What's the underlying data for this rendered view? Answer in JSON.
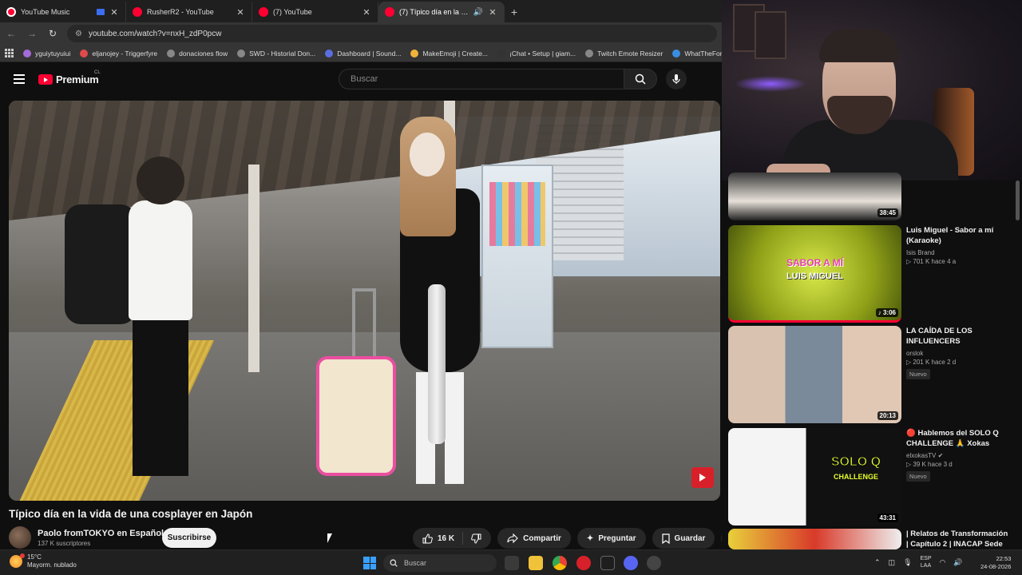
{
  "browser": {
    "tabs": [
      {
        "title": "YouTube Music",
        "icon": "youtube-music-icon"
      },
      {
        "title": "RusherR2 - YouTube",
        "icon": "youtube-icon"
      },
      {
        "title": "(7) YouTube",
        "icon": "youtube-icon"
      },
      {
        "title": "(7) Típico día en la vida de una cosplayer en Japón",
        "icon": "youtube-icon"
      }
    ],
    "url": "youtube.com/watch?v=nxH_zdP0pcw",
    "bookmarks": [
      "yguiytuyuiui",
      "eljanojey - Triggerfyre",
      "donaciones flow",
      "SWD - Historial Don...",
      "Dashboard | Sound...",
      "MakeEmoji | Create...",
      "¡Chat • Setup | giam...",
      "Twitch Emote Resizer",
      "WhatTheFont Font |..."
    ]
  },
  "youtube": {
    "logo_text": "Premium",
    "country_code": "CL",
    "search_placeholder": "Buscar",
    "video": {
      "title": "Típico día en la vida de una cosplayer en Japón",
      "channel_name": "Paolo fromTOKYO en Español",
      "subscribers": "137 K suscriptores",
      "subscribe_label": "Suscribirse",
      "likes": "16 K",
      "share_label": "Compartir",
      "ask_label": "Preguntar",
      "save_label": "Guardar"
    },
    "recommendations": [
      {
        "title": "",
        "channel": "",
        "meta": "",
        "duration": "38:45",
        "badge": ""
      },
      {
        "title": "Luis Miguel - Sabor a mí (Karaoke)",
        "channel": "Isis Brand",
        "meta": "▷ 701 K  hace 4 a",
        "duration": "3:06",
        "badge": "",
        "thumb_text_1": "SABOR A MÍ",
        "thumb_text_2": "LUIS MIGUEL"
      },
      {
        "title": "LA CAÍDA DE LOS INFLUENCERS",
        "channel": "orslok",
        "meta": "▷ 201 K  hace 2 d",
        "duration": "20:13",
        "badge": "Nuevo"
      },
      {
        "title": "🔴 Hablemos del SOLO Q CHALLENGE 🙏 Xokas",
        "channel": "elxokasTV ✔",
        "meta": "▷ 39 K  hace 3 d",
        "duration": "43:31",
        "badge": "Nuevo",
        "thumb_text_1": "SOLO Q",
        "thumb_text_2": "CHALLENGE"
      },
      {
        "title": "| Relatos de Transformación | Capítulo 2 | INACAP Sede",
        "channel": "",
        "meta": "",
        "duration": "",
        "badge": ""
      }
    ]
  },
  "taskbar": {
    "temperature": "15°C",
    "weather_desc": "Mayorm. nublado",
    "search_label": "Buscar",
    "lang_1": "ESP",
    "lang_2": "LAA",
    "time": "22:53",
    "date": "24-08-2026"
  },
  "colors": {
    "youtube_red": "#ff0033",
    "background": "#0f0f0f"
  }
}
